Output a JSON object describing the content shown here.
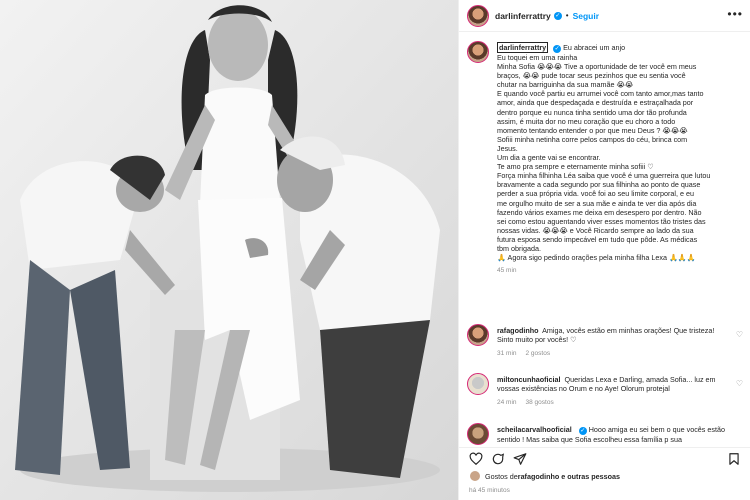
{
  "post": {
    "username": "darlinferrattry",
    "follow_label": "Seguir",
    "separator": "•",
    "more_label": "•••"
  },
  "caption": {
    "username": "darlinferrattry",
    "lines": [
      "Eu abracei um anjo",
      "Eu toquei em uma rainha",
      "Minha Sofia 😭😭😭 Tive a oportunidade de ter você em meus",
      "braços, 😭😭 pude tocar seus pezinhos que eu sentia você",
      "chutar na barriguinha da sua mamãe 😭😭",
      "E quando você partiu eu arrumei você com tanto amor,mas tanto",
      "amor, ainda que despedaçada e destruída e estraçalhada por",
      "dentro porque eu nunca tinha sentido uma dor tão profunda",
      "assim, é muita dor no meu coração que eu choro a todo",
      "momento tentando entender o por que meu Deus ? 😭😭😭",
      "Sofiii minha netinha corre pelos campos do céu, brinca com",
      "Jesus.",
      "Um dia a gente vai se encontrar.",
      "Te amo pra sempre e eternamente minha sofiii ♡",
      "Força minha filhinha Léa saiba que você é uma guerreira que lutou",
      "bravamente a cada segundo por sua filhinha ao ponto de quase",
      "perder a sua própria vida. você foi ao seu limite corporal, e eu",
      "me orgulho muito de ser a sua mãe e ainda te ver dia após dia",
      "fazendo vários exames me deixa em desespero por dentro. Não",
      "sei como estou aguentando viver esses momentos tão tristes das",
      "nossas vidas. 😭😭😭 e Você Ricardo sempre ao lado da sua",
      "futura esposa sendo impecável em tudo que pôde. As médicas",
      "tbm obrigada.",
      "🙏 Agora sigo pedindo orações pela minha filha Lexa 🙏🙏🙏"
    ],
    "time": "45 min"
  },
  "comments": [
    {
      "username": "rafagodinho",
      "text": "Amiga, vocês estão em minhas orações! Que tristeza! Sinto muito por vocês! ♡",
      "time": "31 min",
      "likes": "2 gostos",
      "reply": ""
    },
    {
      "username": "miltoncunhaoficial",
      "text": "Queridas Lexa e Darling, amada Sofia... luz em vossas existências no Orum e no Aye! Olorum protejal",
      "time": "24 min",
      "likes": "38 gostos",
      "reply": ""
    },
    {
      "username": "scheilacarvalhooficial",
      "text": "Hooo amiga eu sei bem o que vocês estão sentido ! Mas saiba que Sofia escolheu essa família p sua",
      "time": "",
      "likes": "",
      "reply": ""
    }
  ],
  "footer": {
    "liked_prefix": "Gostos de ",
    "liked_users": "rafagodinho e outras pessoas",
    "date": "há 45 minutos"
  },
  "icons": {
    "heart": "heart-icon",
    "comment": "comment-icon",
    "share": "share-icon",
    "save": "bookmark-icon"
  },
  "colors": {
    "accent": "#0095f6",
    "muted": "#8e8e8e"
  }
}
